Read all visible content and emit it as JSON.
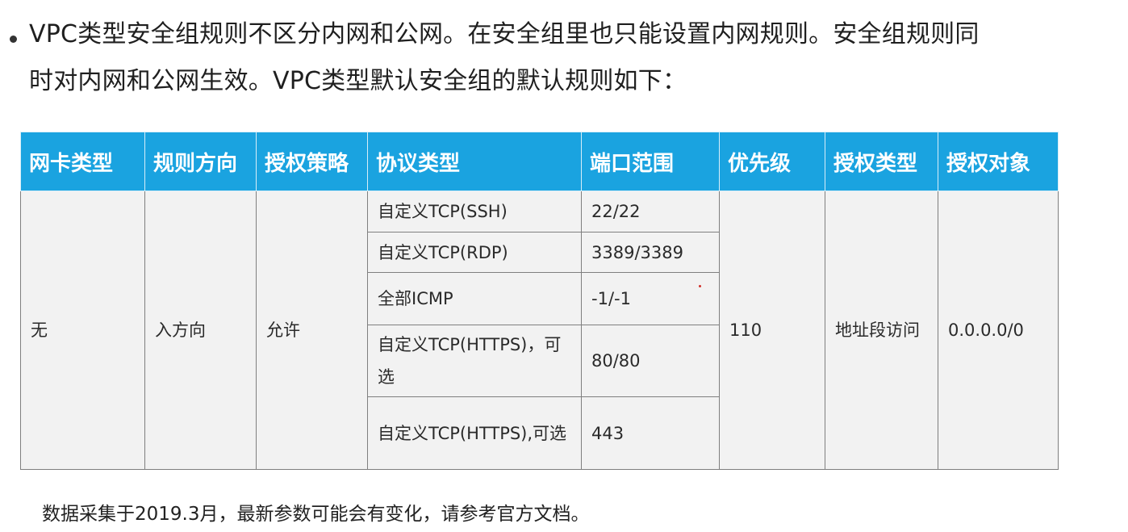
{
  "intro": {
    "line1": "VPC类型安全组规则不区分内网和公网。在安全组里也只能设置内网规则。安全组规则同",
    "line2": "时对内网和公网生效。VPC类型默认安全组的默认规则如下："
  },
  "table": {
    "headers": [
      "网卡类型",
      "规则方向",
      "授权策略",
      "协议类型",
      "端口范围",
      "优先级",
      "授权类型",
      "授权对象"
    ],
    "shared": {
      "nic_type": "无",
      "direction": "入方向",
      "policy": "允许",
      "priority": "110",
      "auth_type": "地址段访问",
      "auth_object": "0.0.0.0/0"
    },
    "rows": [
      {
        "protocol": "自定义TCP(SSH)",
        "port": "22/22"
      },
      {
        "protocol": "自定义TCP(RDP)",
        "port": "3389/3389"
      },
      {
        "protocol": "全部ICMP",
        "port": "-1/-1"
      },
      {
        "protocol": "自定义TCP(HTTPS)，可选",
        "port": "80/80"
      },
      {
        "protocol": "自定义TCP(HTTPS),可选",
        "port": "443"
      }
    ]
  },
  "colors": {
    "header_bg": "#1aa3e0",
    "header_text": "#ffffff",
    "cell_bg": "#f2f2f2"
  },
  "footnote": "数据采集于2019.3月，最新参数可能会有变化，请参考官方文档。"
}
